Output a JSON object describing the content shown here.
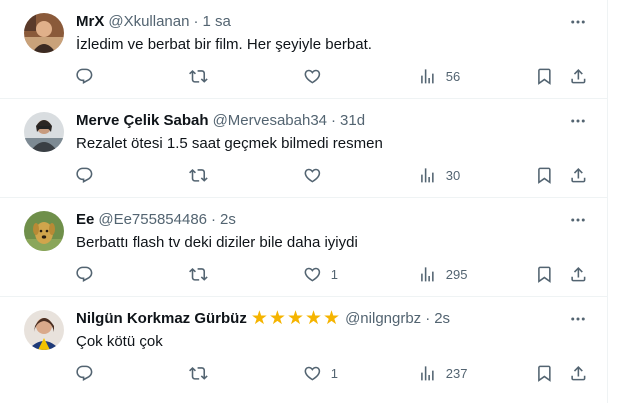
{
  "replies": [
    {
      "name": "MrX",
      "handle": "@Xkullanan",
      "time": "1 sa",
      "text": "İzledim ve berbat bir film. Her şeyiyle berbat.",
      "likes": "",
      "views": "56",
      "stars": 0,
      "avatar": "avatar-photo-person"
    },
    {
      "name": "Merve Çelik Sabah",
      "handle": "@Mervesabah34",
      "time": "31d",
      "text": "Rezalet ötesi 1.5 saat geçmek bilmedi resmen",
      "likes": "",
      "views": "30",
      "stars": 0,
      "avatar": "avatar-photo-person"
    },
    {
      "name": "Ee",
      "handle": "@Ee755854486",
      "time": "2s",
      "text": "Berbattı flash tv deki diziler bile daha iyiydi",
      "likes": "1",
      "views": "295",
      "stars": 0,
      "avatar": "avatar-photo-dog"
    },
    {
      "name": "Nilgün Korkmaz Gürbüz",
      "handle": "@nilgngrbz",
      "time": "2s",
      "text": "Çok kötü çok",
      "likes": "1",
      "views": "237",
      "stars": 5,
      "avatar": "avatar-photo-person"
    }
  ],
  "separator": "·",
  "icons": {
    "reply": "reply-icon",
    "retweet": "retweet-icon",
    "like": "like-icon",
    "views": "views-icon",
    "bookmark": "bookmark-icon",
    "share": "share-icon",
    "more": "more-icon"
  },
  "colors": {
    "text_primary": "#0f1419",
    "text_secondary": "#536471",
    "divider": "#eff3f4",
    "star": "#f5b400"
  }
}
